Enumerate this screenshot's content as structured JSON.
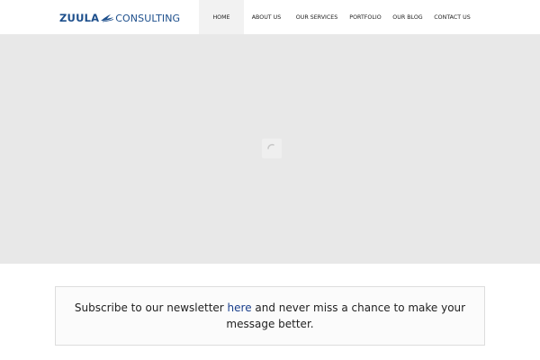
{
  "brand": {
    "name_part1": "ZUULA",
    "name_part2": "CONSULTING",
    "color": "#1d4f8c",
    "icon": "bird-icon"
  },
  "nav": {
    "items": [
      {
        "label": "HOME",
        "active": true
      },
      {
        "label": "ABOUT US",
        "active": false
      },
      {
        "label": "OUR SERVICES",
        "active": false
      },
      {
        "label": "PORTFOLIO",
        "active": false
      },
      {
        "label": "OUR BLOG",
        "active": false
      },
      {
        "label": "CONTACT US",
        "active": false
      }
    ]
  },
  "hero": {
    "background": "#e8e8e8",
    "loader_icon": "loading-spinner-icon"
  },
  "newsletter": {
    "text_before": "Subscribe to our newsletter ",
    "link_text": "here",
    "text_after": " and never miss a chance to make your message better.",
    "link_color": "#1a3f8c"
  }
}
